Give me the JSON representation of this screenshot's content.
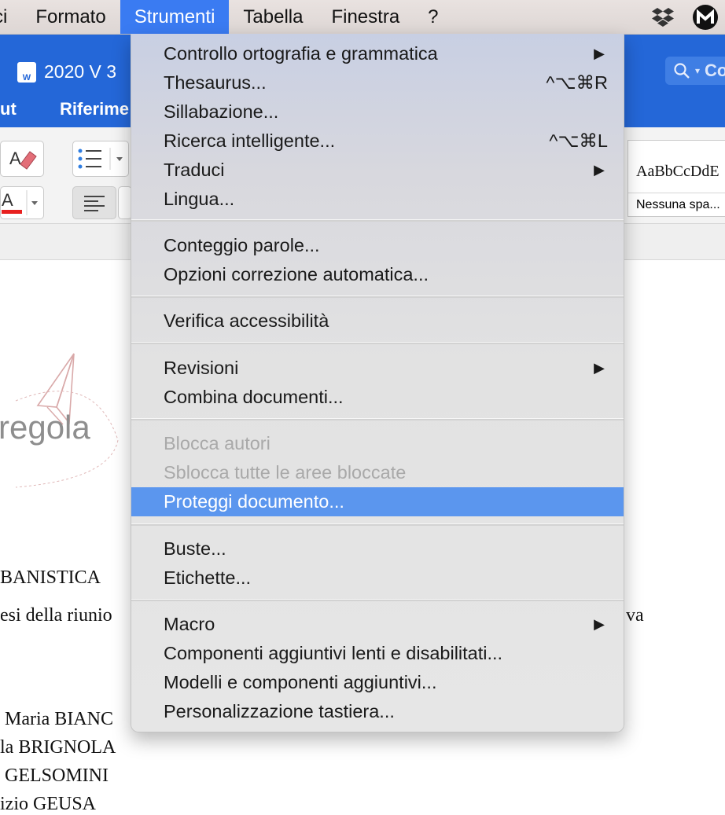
{
  "menubar": {
    "items": [
      "ci",
      "Formato",
      "Strumenti",
      "Tabella",
      "Finestra",
      "?"
    ],
    "active": "Strumenti"
  },
  "window": {
    "title": "2020 V 3",
    "search_placeholder": "Co",
    "ribbon_tabs": [
      "ut",
      "Riferime"
    ]
  },
  "ribbon": {
    "style_preview": "AaBbCcDdE",
    "style_name": "Nessuna spa..."
  },
  "document": {
    "logo_text": "regola",
    "lines": [
      "BANISTICA",
      "esi della riunio",
      "va",
      "Maria BIANC",
      "la BRIGNOLA",
      "GELSOMINI",
      "izio GEUSA"
    ]
  },
  "menu": {
    "groups": [
      [
        {
          "label": "Controllo ortografia e grammatica",
          "submenu": true
        },
        {
          "label": "Thesaurus...",
          "shortcut": "^⌥⌘R"
        },
        {
          "label": "Sillabazione..."
        },
        {
          "label": "Ricerca intelligente...",
          "shortcut": "^⌥⌘L"
        },
        {
          "label": "Traduci",
          "submenu": true
        },
        {
          "label": "Lingua..."
        }
      ],
      [
        {
          "label": "Conteggio parole..."
        },
        {
          "label": "Opzioni correzione automatica..."
        }
      ],
      [
        {
          "label": "Verifica accessibilità"
        }
      ],
      [
        {
          "label": "Revisioni",
          "submenu": true
        },
        {
          "label": "Combina documenti..."
        }
      ],
      [
        {
          "label": "Blocca autori",
          "disabled": true
        },
        {
          "label": "Sblocca tutte le aree bloccate",
          "disabled": true
        },
        {
          "label": "Proteggi documento...",
          "highlighted": true
        }
      ],
      [
        {
          "label": "Buste..."
        },
        {
          "label": "Etichette..."
        }
      ],
      [
        {
          "label": "Macro",
          "submenu": true
        },
        {
          "label": "Componenti aggiuntivi lenti e disabilitati..."
        },
        {
          "label": "Modelli e componenti aggiuntivi..."
        },
        {
          "label": "Personalizzazione tastiera..."
        }
      ]
    ]
  },
  "icons": {
    "submenu_arrow": "▶",
    "search": "search-icon",
    "dropbox": "dropbox-icon"
  },
  "colors": {
    "accent": "#3a7bf2",
    "highlight": "#5b96ee",
    "word_blue": "#2467d8"
  }
}
